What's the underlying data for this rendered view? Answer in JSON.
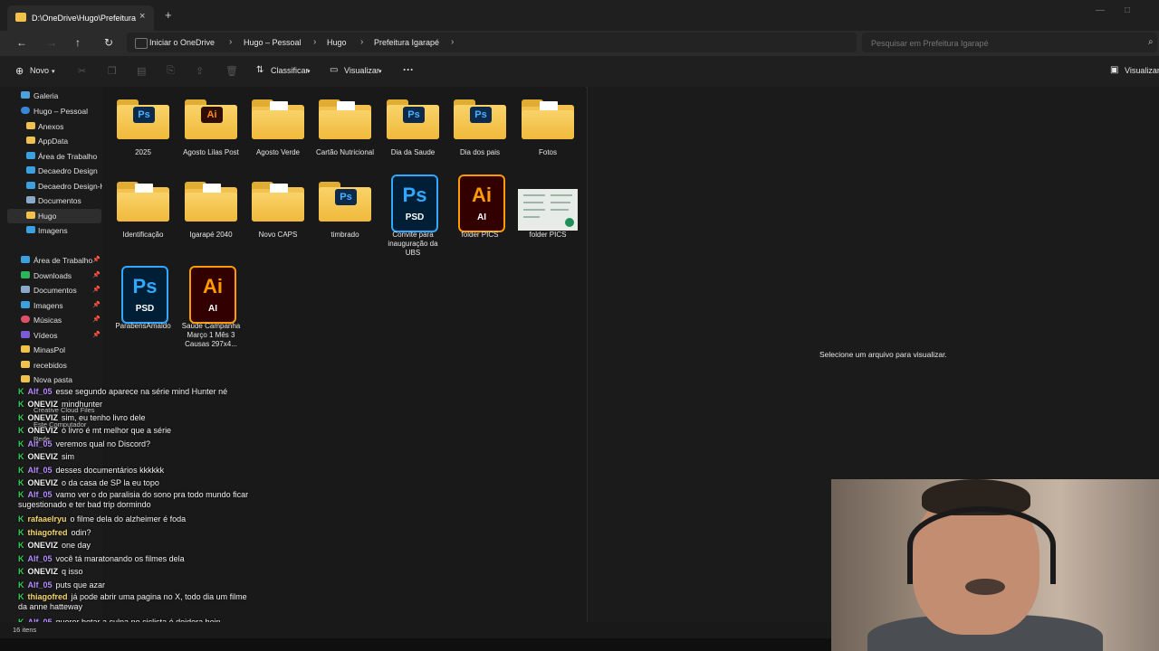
{
  "titlebar": {
    "tab_title": "D:\\OneDrive\\Hugo\\Prefeitura",
    "close_glyph": "×",
    "newtab_glyph": "+"
  },
  "nav": {
    "back_glyph": "←",
    "forward_glyph": "→",
    "up_glyph": "↑",
    "refresh_glyph": "↻",
    "breadcrumbs": [
      "Iniciar o OneDrive",
      "Hugo – Pessoal",
      "Hugo",
      "Prefeitura Igarapé"
    ],
    "sep_glyph": "›"
  },
  "search": {
    "placeholder": "Pesquisar em Prefeitura Igarapé"
  },
  "toolbar": {
    "new_label": "Novo",
    "sort_label": "Classificar",
    "view_label": "Visualizar",
    "more_glyph": "···",
    "preview_label": "Visualizar"
  },
  "sidebar": {
    "items": [
      {
        "label": "Galeria",
        "color": "#4aa3df",
        "indent": 0
      },
      {
        "label": "Hugo – Pessoal",
        "color": "#3a86d6",
        "indent": 0
      },
      {
        "label": "Anexos",
        "color": "#f0c14b",
        "indent": 1
      },
      {
        "label": "AppData",
        "color": "#f0c14b",
        "indent": 1
      },
      {
        "label": "Área de Trabalho",
        "color": "#3aa0e0",
        "indent": 1
      },
      {
        "label": "Decaedro Design",
        "color": "#3aa0e0",
        "indent": 1
      },
      {
        "label": "Decaedro Design-H",
        "color": "#3aa0e0",
        "indent": 1
      },
      {
        "label": "Documentos",
        "color": "#8aa9c9",
        "indent": 1
      },
      {
        "label": "Hugo",
        "color": "#f0c14b",
        "indent": 1
      },
      {
        "label": "Imagens",
        "color": "#3aa0e0",
        "indent": 1
      }
    ],
    "quick": [
      {
        "label": "Área de Trabalho",
        "color": "#3aa0e0"
      },
      {
        "label": "Downloads",
        "color": "#2fb35a"
      },
      {
        "label": "Documentos",
        "color": "#8aa9c9"
      },
      {
        "label": "Imagens",
        "color": "#3aa0e0"
      },
      {
        "label": "Músicas",
        "color": "#e0506a"
      },
      {
        "label": "Vídeos",
        "color": "#7a5cd6"
      },
      {
        "label": "MinasPol",
        "color": "#f0c14b"
      },
      {
        "label": "recebidos",
        "color": "#f0c14b"
      },
      {
        "label": "Nova pasta",
        "color": "#f0c14b"
      }
    ],
    "bottom": [
      "Creative Cloud Files",
      "Este Computador",
      "Rede"
    ],
    "pin_glyph": "📌"
  },
  "files": [
    {
      "label": "2025",
      "kind": "folder",
      "badge": "Ps"
    },
    {
      "label": "Agosto Lilas Post",
      "kind": "folder",
      "badge": "Ai"
    },
    {
      "label": "Agosto Verde",
      "kind": "folder",
      "badge": ""
    },
    {
      "label": "Cartão Nutricional",
      "kind": "folder",
      "badge": ""
    },
    {
      "label": "Dia da Saude",
      "kind": "folder",
      "badge": "Ps"
    },
    {
      "label": "Dia dos pais",
      "kind": "folder",
      "badge": "Ps"
    },
    {
      "label": "Fotos",
      "kind": "folder",
      "badge": ""
    },
    {
      "label": "Identificação",
      "kind": "folder",
      "badge": ""
    },
    {
      "label": "Igarapé 2040",
      "kind": "folder",
      "badge": ""
    },
    {
      "label": "Novo CAPS",
      "kind": "folder",
      "badge": ""
    },
    {
      "label": "timbrado",
      "kind": "folder",
      "badge": "Ps"
    },
    {
      "label": "Convite para inauguração da UBS",
      "kind": "psd",
      "badge": ""
    },
    {
      "label": "folder PICS",
      "kind": "ai",
      "badge": ""
    },
    {
      "label": "folder PICS",
      "kind": "image",
      "badge": ""
    },
    {
      "label": "ParabensAmaldo",
      "kind": "psd",
      "badge": ""
    },
    {
      "label": "Saúde Campanha Março 1 Mês 3 Causas 297x4...",
      "kind": "ai",
      "badge": ""
    }
  ],
  "filetype": {
    "ps_big": "Ps",
    "ai_big": "Ai",
    "psd": "PSD",
    "ai": "AI"
  },
  "preview": {
    "message": "Selecione um arquivo para visualizar."
  },
  "chat": {
    "check_glyph": "K",
    "lines": [
      {
        "user": "Alf_05",
        "color": "#b58cff",
        "text": "esse segundo aparece na série mind Hunter né"
      },
      {
        "user": "ONEVIZ",
        "color": "#ffffff",
        "text": "mindhunter"
      },
      {
        "user": "ONEVIZ",
        "color": "#ffffff",
        "text": "sim, eu tenho livro dele"
      },
      {
        "user": "ONEVIZ",
        "color": "#ffffff",
        "text": "o livro é mt melhor que a série"
      },
      {
        "user": "Alf_05",
        "color": "#b58cff",
        "text": "veremos qual no Discord?"
      },
      {
        "user": "ONEVIZ",
        "color": "#ffffff",
        "text": "sim"
      },
      {
        "user": "Alf_05",
        "color": "#b58cff",
        "text": "desses documentários kkkkkk"
      },
      {
        "user": "ONEVIZ",
        "color": "#ffffff",
        "text": "o da casa de SP la eu topo"
      },
      {
        "user": "Alf_05",
        "color": "#b58cff",
        "text": "vamo ver o do paralisia do sono pra todo mundo ficar sugestionado e ter bad trip dormindo"
      },
      {
        "user": "rafaaelryu",
        "color": "#f5d76e",
        "text": "o filme dela do alzheimer é foda"
      },
      {
        "user": "thiagofred",
        "color": "#f5d76e",
        "text": "odin?"
      },
      {
        "user": "ONEVIZ",
        "color": "#ffffff",
        "text": "one day"
      },
      {
        "user": "Alf_05",
        "color": "#b58cff",
        "text": "você tá maratonando os filmes dela"
      },
      {
        "user": "ONEVIZ",
        "color": "#ffffff",
        "text": "q isso"
      },
      {
        "user": "Alf_05",
        "color": "#b58cff",
        "text": "puts que azar"
      },
      {
        "user": "thiagofred",
        "color": "#f5d76e",
        "text": "já pode abrir uma pagina no X, todo dia um filme da anne hatteway"
      },
      {
        "user": "Alf_05",
        "color": "#b58cff",
        "text": "querer botar a culpa no ciclista é doidera hein"
      }
    ]
  },
  "status": {
    "count": "16 itens"
  }
}
